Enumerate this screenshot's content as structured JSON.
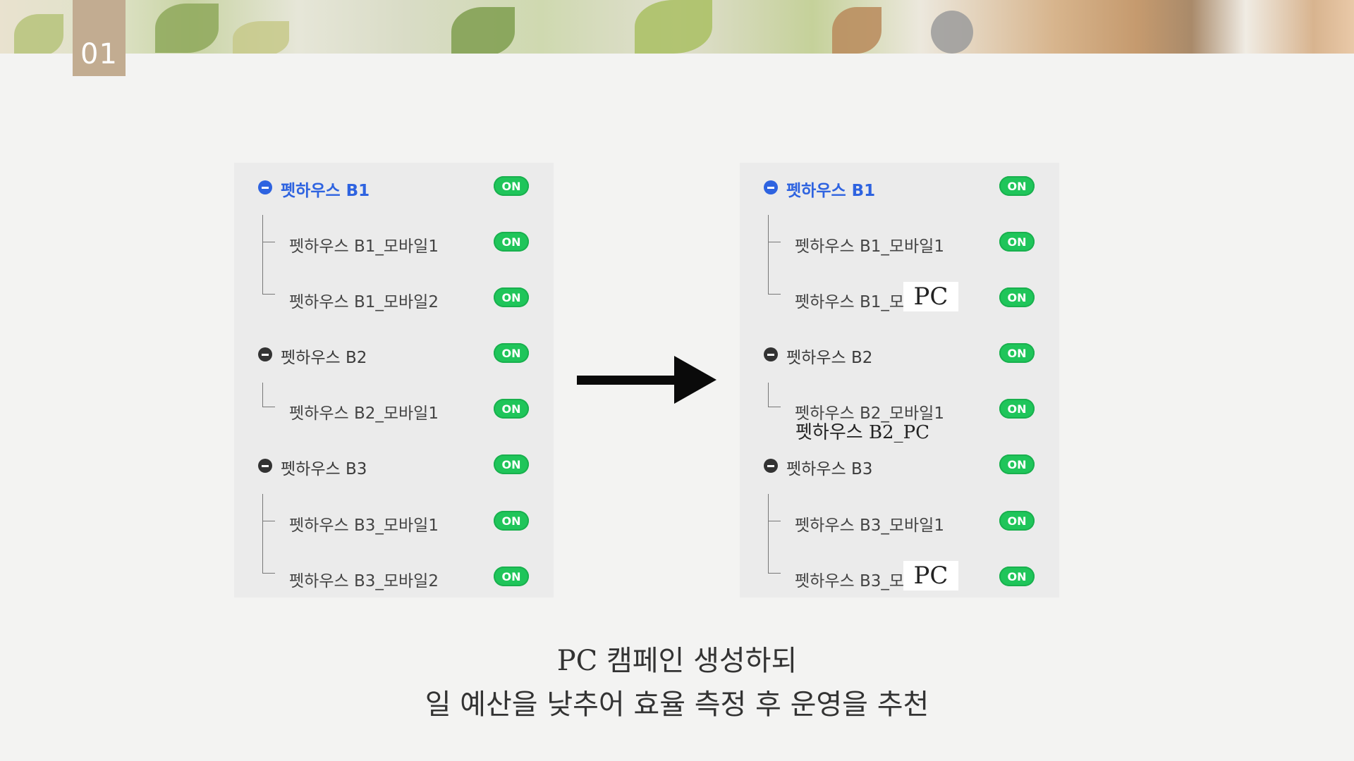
{
  "slide": {
    "number": "01"
  },
  "before_list": [
    {
      "label": "펫하우스 B1",
      "level": "parent",
      "active": true,
      "status": "ON"
    },
    {
      "label": "펫하우스 B1_모바일1",
      "level": "child",
      "status": "ON"
    },
    {
      "label": "펫하우스 B1_모바일2",
      "level": "child",
      "status": "ON"
    },
    {
      "label": "펫하우스 B2",
      "level": "parent",
      "status": "ON"
    },
    {
      "label": "펫하우스 B2_모바일1",
      "level": "child",
      "status": "ON"
    },
    {
      "label": "펫하우스 B3",
      "level": "parent",
      "status": "ON"
    },
    {
      "label": "펫하우스 B3_모바일1",
      "level": "child",
      "status": "ON"
    },
    {
      "label": "펫하우스 B3_모바일2",
      "level": "child",
      "status": "ON"
    }
  ],
  "after_list": [
    {
      "label": "펫하우스 B1",
      "level": "parent",
      "active": true,
      "status": "ON"
    },
    {
      "label": "펫하우스 B1_모바일1",
      "level": "child",
      "status": "ON"
    },
    {
      "label": "펫하우스 B1_모바일2",
      "level": "child",
      "status": "ON",
      "overlay": "PC"
    },
    {
      "label": "펫하우스 B2",
      "level": "parent",
      "status": "ON"
    },
    {
      "label": "펫하우스 B2_모바일1",
      "level": "child",
      "status": "ON"
    },
    {
      "label": "펫하우스 B3",
      "level": "parent",
      "status": "ON"
    },
    {
      "label": "펫하우스 B3_모바일1",
      "level": "child",
      "status": "ON"
    },
    {
      "label": "펫하우스 B3_모바일2",
      "level": "child",
      "status": "ON",
      "overlay": "PC"
    }
  ],
  "after_note": "펫하우스 B2_PC",
  "caption": {
    "line1": "PC 캠페인 생성하되",
    "line2": "일 예산을 낮추어 효율 측정 후 운영을 추천"
  },
  "colors": {
    "toggle_on": "#1fc55a",
    "active_text": "#2e63e0",
    "badge": "#c2ac91",
    "panel": "#ebebeb"
  }
}
